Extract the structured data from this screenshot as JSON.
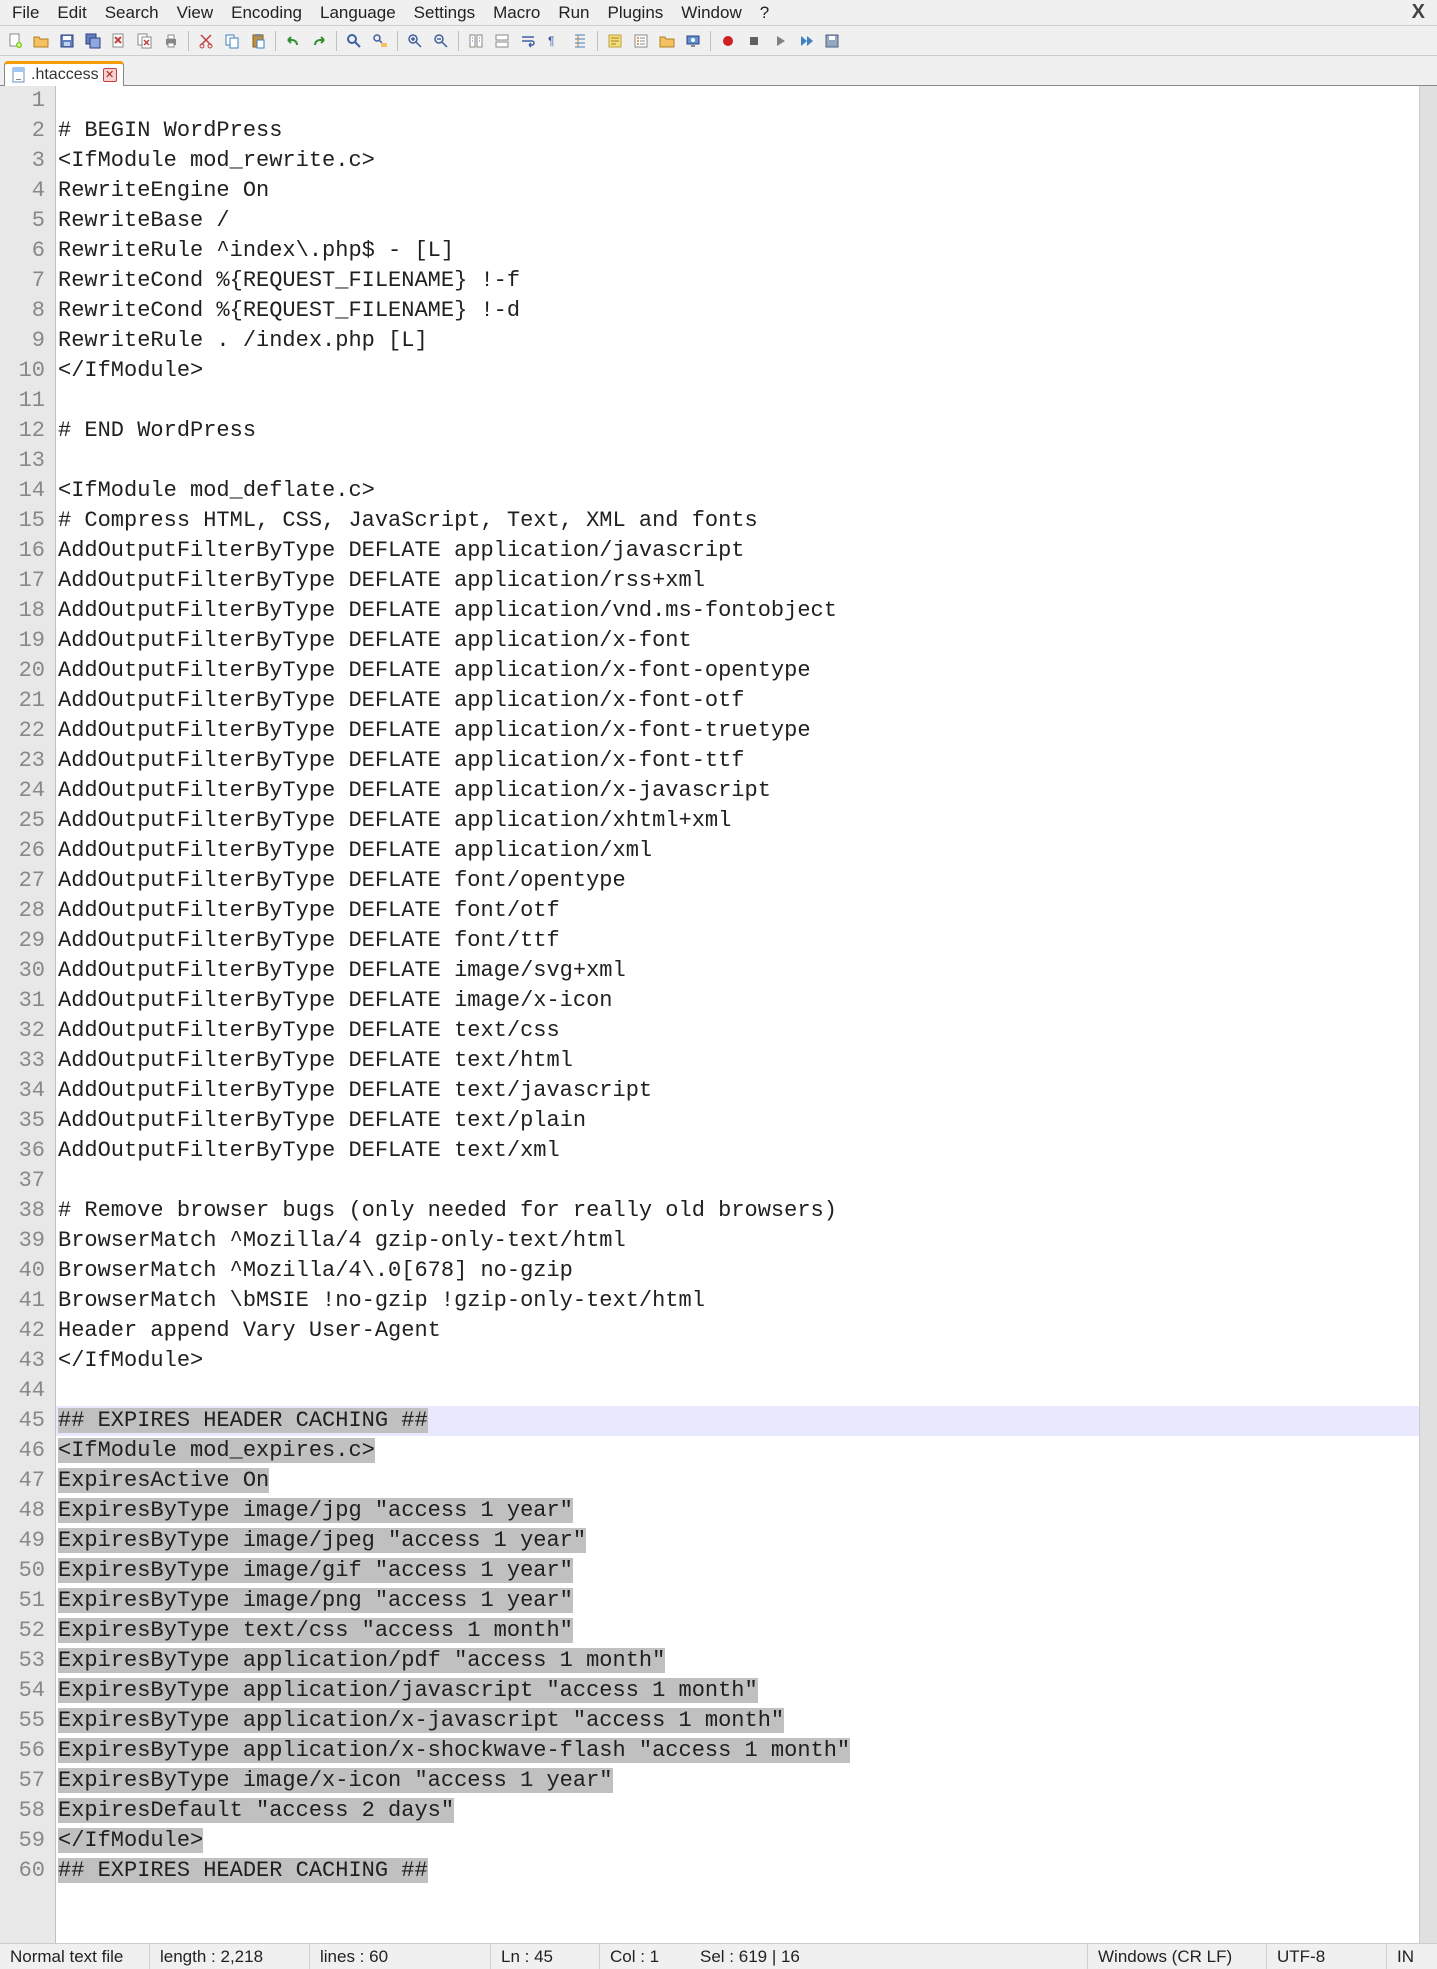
{
  "menu": [
    "File",
    "Edit",
    "Search",
    "View",
    "Encoding",
    "Language",
    "Settings",
    "Macro",
    "Run",
    "Plugins",
    "Window",
    "?"
  ],
  "toolbar_icons": [
    "new-file-icon",
    "open-file-icon",
    "save-icon",
    "save-all-icon",
    "close-icon",
    "close-all-icon",
    "print-icon",
    "__sep",
    "cut-icon",
    "copy-icon",
    "paste-icon",
    "__sep",
    "undo-icon",
    "redo-icon",
    "__sep",
    "find-icon",
    "replace-icon",
    "__sep",
    "zoom-in-icon",
    "zoom-out-icon",
    "__sep",
    "sync-v-icon",
    "sync-h-icon",
    "wrap-icon",
    "show-all-icon",
    "indent-guide-icon",
    "__sep",
    "doc-map-icon",
    "func-list-icon",
    "folder-icon",
    "monitor-icon",
    "__sep",
    "record-icon",
    "stop-icon",
    "play-icon",
    "play-multi-icon",
    "save-macro-icon"
  ],
  "tab": {
    "label": ".htaccess"
  },
  "code": {
    "highlight_line": 45,
    "selection_start": 45,
    "selection_end": 60,
    "lines": [
      "",
      "# BEGIN WordPress",
      "<IfModule mod_rewrite.c>",
      "RewriteEngine On",
      "RewriteBase /",
      "RewriteRule ^index\\.php$ - [L]",
      "RewriteCond %{REQUEST_FILENAME} !-f",
      "RewriteCond %{REQUEST_FILENAME} !-d",
      "RewriteRule . /index.php [L]",
      "</IfModule>",
      "",
      "# END WordPress",
      "",
      "<IfModule mod_deflate.c>",
      "# Compress HTML, CSS, JavaScript, Text, XML and fonts",
      "AddOutputFilterByType DEFLATE application/javascript",
      "AddOutputFilterByType DEFLATE application/rss+xml",
      "AddOutputFilterByType DEFLATE application/vnd.ms-fontobject",
      "AddOutputFilterByType DEFLATE application/x-font",
      "AddOutputFilterByType DEFLATE application/x-font-opentype",
      "AddOutputFilterByType DEFLATE application/x-font-otf",
      "AddOutputFilterByType DEFLATE application/x-font-truetype",
      "AddOutputFilterByType DEFLATE application/x-font-ttf",
      "AddOutputFilterByType DEFLATE application/x-javascript",
      "AddOutputFilterByType DEFLATE application/xhtml+xml",
      "AddOutputFilterByType DEFLATE application/xml",
      "AddOutputFilterByType DEFLATE font/opentype",
      "AddOutputFilterByType DEFLATE font/otf",
      "AddOutputFilterByType DEFLATE font/ttf",
      "AddOutputFilterByType DEFLATE image/svg+xml",
      "AddOutputFilterByType DEFLATE image/x-icon",
      "AddOutputFilterByType DEFLATE text/css",
      "AddOutputFilterByType DEFLATE text/html",
      "AddOutputFilterByType DEFLATE text/javascript",
      "AddOutputFilterByType DEFLATE text/plain",
      "AddOutputFilterByType DEFLATE text/xml",
      "",
      "# Remove browser bugs (only needed for really old browsers)",
      "BrowserMatch ^Mozilla/4 gzip-only-text/html",
      "BrowserMatch ^Mozilla/4\\.0[678] no-gzip",
      "BrowserMatch \\bMSIE !no-gzip !gzip-only-text/html",
      "Header append Vary User-Agent",
      "</IfModule>",
      "",
      "## EXPIRES HEADER CACHING ##",
      "<IfModule mod_expires.c>",
      "ExpiresActive On",
      "ExpiresByType image/jpg \"access 1 year\"",
      "ExpiresByType image/jpeg \"access 1 year\"",
      "ExpiresByType image/gif \"access 1 year\"",
      "ExpiresByType image/png \"access 1 year\"",
      "ExpiresByType text/css \"access 1 month\"",
      "ExpiresByType application/pdf \"access 1 month\"",
      "ExpiresByType application/javascript \"access 1 month\"",
      "ExpiresByType application/x-javascript \"access 1 month\"",
      "ExpiresByType application/x-shockwave-flash \"access 1 month\"",
      "ExpiresByType image/x-icon \"access 1 year\"",
      "ExpiresDefault \"access 2 days\"",
      "</IfModule>",
      "## EXPIRES HEADER CACHING ##"
    ]
  },
  "status": {
    "filetype": "Normal text file",
    "length": "length : 2,218",
    "lines": "lines : 60",
    "ln": "Ln : 45",
    "col": "Col : 1",
    "sel": "Sel : 619 | 16",
    "eol": "Windows (CR LF)",
    "encoding": "UTF-8",
    "ovr": "IN"
  }
}
